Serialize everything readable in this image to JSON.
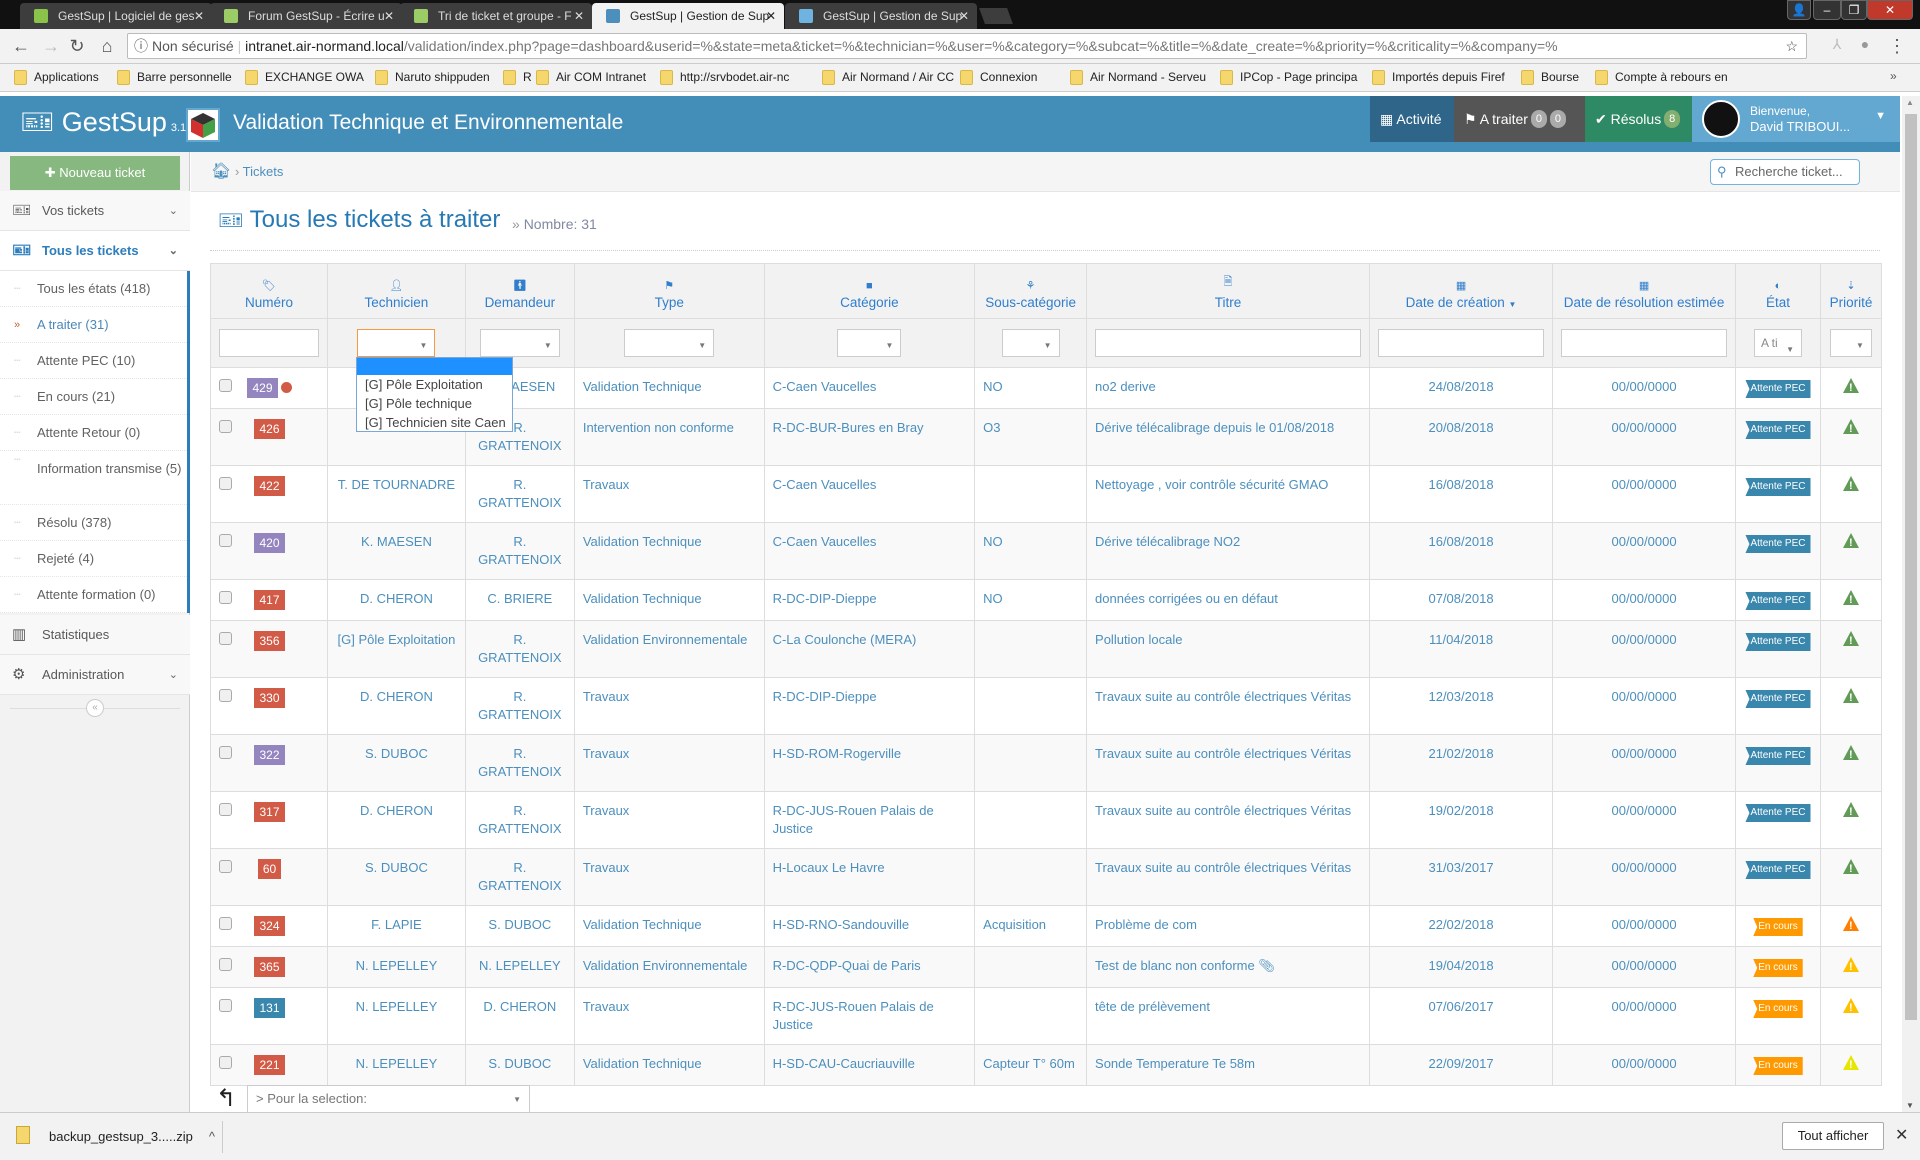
{
  "browser": {
    "tabs": [
      {
        "title": "GestSup | Logiciel de ges",
        "active": false,
        "color": "#8bc34a"
      },
      {
        "title": "Forum GestSup - Écrire u",
        "active": false,
        "color": "#9ccc65"
      },
      {
        "title": "Tri de ticket et groupe - F",
        "active": false,
        "color": "#9ccc65"
      },
      {
        "title": "GestSup | Gestion de Sup",
        "active": true,
        "color": "#4c8fbd"
      },
      {
        "title": "GestSup | Gestion de Sup",
        "active": false,
        "color": "#6fb3e0"
      }
    ],
    "address": {
      "security": "Non sécurisé",
      "host": "intranet.air-normand.local",
      "path": "/validation/index.php?page=dashboard&userid=%&state=meta&ticket=%&technician=%&user=%&category=%&subcat=%&title=%&date_create=%&priority=%&criticality=%&company=%"
    },
    "bookmarks": [
      "Applications",
      "Barre personnelle",
      "EXCHANGE OWA",
      "Naruto shippuden",
      "R",
      "Air COM Intranet",
      "http://srvbodet.air-nc",
      "Air Normand / Air CC",
      "Connexion",
      "Air Normand - Serveu",
      "IPCop - Page principa",
      "Importés depuis Firef",
      "Bourse",
      "Compte à rebours en"
    ],
    "bookmarks_overflow": "»"
  },
  "header": {
    "logo": "GestSup",
    "version": "3.1.34",
    "title": "Validation Technique et Environnementale",
    "nav": {
      "activity": "Activité",
      "to_process": "A traiter",
      "to_process_badges": [
        "0",
        "0"
      ],
      "resolved": "Résolus",
      "resolved_badge": "8"
    },
    "user": {
      "greeting": "Bienvenue,",
      "name": "David TRIBOUI..."
    }
  },
  "sidebar": {
    "new_ticket": "Nouveau ticket",
    "your_tickets": "Vos tickets",
    "all_tickets": "Tous les tickets",
    "sub_items": [
      {
        "label": "Tous les états (418)"
      },
      {
        "label": "A traiter (31)",
        "selected": true
      },
      {
        "label": "Attente PEC (10)"
      },
      {
        "label": "En cours (21)"
      },
      {
        "label": "Attente Retour (0)"
      },
      {
        "label": "Information transmise (5)"
      },
      {
        "label": "Résolu (378)"
      },
      {
        "label": "Rejeté (4)"
      },
      {
        "label": "Attente formation (0)"
      }
    ],
    "stats": "Statistiques",
    "admin": "Administration"
  },
  "breadcrumb": {
    "item": "Tickets"
  },
  "search": {
    "placeholder": "Recherche ticket..."
  },
  "page": {
    "title": "Tous les tickets à traiter",
    "count_label": "Nombre: 31"
  },
  "table": {
    "columns": [
      "Numéro",
      "Technicien",
      "Demandeur",
      "Type",
      "Catégorie",
      "Sous-catégorie",
      "Titre",
      "Date de création",
      "Date de résolution estimée",
      "État",
      "Priorité"
    ],
    "state_filter_value": "A ti",
    "technician_dropdown": [
      "",
      "[G] Pôle Exploitation",
      "[G] Pôle technique",
      "[G] Technicien site Caen"
    ],
    "rows": [
      {
        "num": "429",
        "num_color": "#9585bf",
        "new": true,
        "tech": "",
        "req": "K. MAESEN",
        "type": "Validation Technique",
        "cat": "C-Caen Vaucelles",
        "subcat": "NO",
        "title": "no2 derive",
        "created": "24/08/2018",
        "due": "00/00/0000",
        "state": "Attente PEC",
        "state_color": "#3a87ad",
        "prio_color": "#629b58"
      },
      {
        "num": "426",
        "num_color": "#d15b47",
        "tech": "",
        "req": "R. GRATTENOIX",
        "type": "Intervention non conforme",
        "cat": "R-DC-BUR-Bures en Bray",
        "subcat": "O3",
        "title": "Dérive télécalibrage depuis le 01/08/2018",
        "created": "20/08/2018",
        "due": "00/00/0000",
        "state": "Attente PEC",
        "state_color": "#3a87ad",
        "prio_color": "#629b58"
      },
      {
        "num": "422",
        "num_color": "#d15b47",
        "tech": "T. DE TOURNADRE",
        "req": "R. GRATTENOIX",
        "type": "Travaux",
        "cat": "C-Caen Vaucelles",
        "subcat": "",
        "title": "Nettoyage , voir contrôle sécurité GMAO",
        "created": "16/08/2018",
        "due": "00/00/0000",
        "state": "Attente PEC",
        "state_color": "#3a87ad",
        "prio_color": "#629b58"
      },
      {
        "num": "420",
        "num_color": "#9585bf",
        "tech": "K. MAESEN",
        "req": "R. GRATTENOIX",
        "type": "Validation Technique",
        "cat": "C-Caen Vaucelles",
        "subcat": "NO",
        "title": "Dérive télécalibrage NO2",
        "created": "16/08/2018",
        "due": "00/00/0000",
        "state": "Attente PEC",
        "state_color": "#3a87ad",
        "prio_color": "#629b58"
      },
      {
        "num": "417",
        "num_color": "#d15b47",
        "tech": "D. CHERON",
        "req": "C. BRIERE",
        "type": "Validation Technique",
        "cat": "R-DC-DIP-Dieppe",
        "subcat": "NO",
        "title": "données corrigées ou en défaut",
        "created": "07/08/2018",
        "due": "00/00/0000",
        "state": "Attente PEC",
        "state_color": "#3a87ad",
        "prio_color": "#629b58"
      },
      {
        "num": "356",
        "num_color": "#d15b47",
        "tech": "[G] Pôle Exploitation",
        "req": "R. GRATTENOIX",
        "type": "Validation Environnementale",
        "cat": "C-La Coulonche (MERA)",
        "subcat": "",
        "title": "Pollution locale",
        "created": "11/04/2018",
        "due": "00/00/0000",
        "state": "Attente PEC",
        "state_color": "#3a87ad",
        "prio_color": "#629b58"
      },
      {
        "num": "330",
        "num_color": "#d15b47",
        "tech": "D. CHERON",
        "req": "R. GRATTENOIX",
        "type": "Travaux",
        "cat": "R-DC-DIP-Dieppe",
        "subcat": "",
        "title": "Travaux suite au contrôle électriques Véritas",
        "created": "12/03/2018",
        "due": "00/00/0000",
        "state": "Attente PEC",
        "state_color": "#3a87ad",
        "prio_color": "#629b58"
      },
      {
        "num": "322",
        "num_color": "#9585bf",
        "tech": "S. DUBOC",
        "req": "R. GRATTENOIX",
        "type": "Travaux",
        "cat": "H-SD-ROM-Rogerville",
        "subcat": "",
        "title": "Travaux suite au contrôle électriques Véritas",
        "created": "21/02/2018",
        "due": "00/00/0000",
        "state": "Attente PEC",
        "state_color": "#3a87ad",
        "prio_color": "#629b58"
      },
      {
        "num": "317",
        "num_color": "#d15b47",
        "tech": "D. CHERON",
        "req": "R. GRATTENOIX",
        "type": "Travaux",
        "cat": "R-DC-JUS-Rouen Palais de Justice",
        "subcat": "",
        "title": "Travaux suite au contrôle électriques Véritas",
        "created": "19/02/2018",
        "due": "00/00/0000",
        "state": "Attente PEC",
        "state_color": "#3a87ad",
        "prio_color": "#629b58"
      },
      {
        "num": "60",
        "num_color": "#d15b47",
        "tech": "S. DUBOC",
        "req": "R. GRATTENOIX",
        "type": "Travaux",
        "cat": "H-Locaux Le Havre",
        "subcat": "",
        "title": "Travaux suite au contrôle électriques Véritas",
        "created": "31/03/2017",
        "due": "00/00/0000",
        "state": "Attente PEC",
        "state_color": "#3a87ad",
        "prio_color": "#629b58"
      },
      {
        "num": "324",
        "num_color": "#d15b47",
        "tech": "F. LAPIE",
        "req": "S. DUBOC",
        "type": "Validation Technique",
        "cat": "H-SD-RNO-Sandouville",
        "subcat": "Acquisition",
        "title": "Problème de com",
        "created": "22/02/2018",
        "due": "00/00/0000",
        "state": "En cours",
        "state_color": "#ff9900",
        "prio_color": "#ff7f00"
      },
      {
        "num": "365",
        "num_color": "#d15b47",
        "tech": "N. LEPELLEY",
        "req": "N. LEPELLEY",
        "type": "Validation Environnementale",
        "cat": "R-DC-QDP-Quai de Paris",
        "subcat": "",
        "title": "Test de blanc non conforme",
        "attachment": true,
        "created": "19/04/2018",
        "due": "00/00/0000",
        "state": "En cours",
        "state_color": "#ff9900",
        "prio_color": "#ffc000"
      },
      {
        "num": "131",
        "num_color": "#3a87ad",
        "tech": "N. LEPELLEY",
        "req": "D. CHERON",
        "type": "Travaux",
        "cat": "R-DC-JUS-Rouen Palais de Justice",
        "subcat": "",
        "title": "tête de prélèvement",
        "created": "07/06/2017",
        "due": "00/00/0000",
        "state": "En cours",
        "state_color": "#ff9900",
        "prio_color": "#ffc000"
      },
      {
        "num": "221",
        "num_color": "#d15b47",
        "tech": "N. LEPELLEY",
        "req": "S. DUBOC",
        "type": "Validation Technique",
        "cat": "H-SD-CAU-Caucriauville",
        "subcat": "Capteur T° 60m",
        "title": "Sonde Temperature Te 58m",
        "created": "22/09/2017",
        "due": "00/00/0000",
        "state": "En cours",
        "state_color": "#ff9900",
        "prio_color": "#e6e600"
      }
    ]
  },
  "bulk": {
    "placeholder": "> Pour la selection:"
  },
  "downloads": {
    "file": "backup_gestsup_3.....zip",
    "show_all": "Tout afficher"
  }
}
